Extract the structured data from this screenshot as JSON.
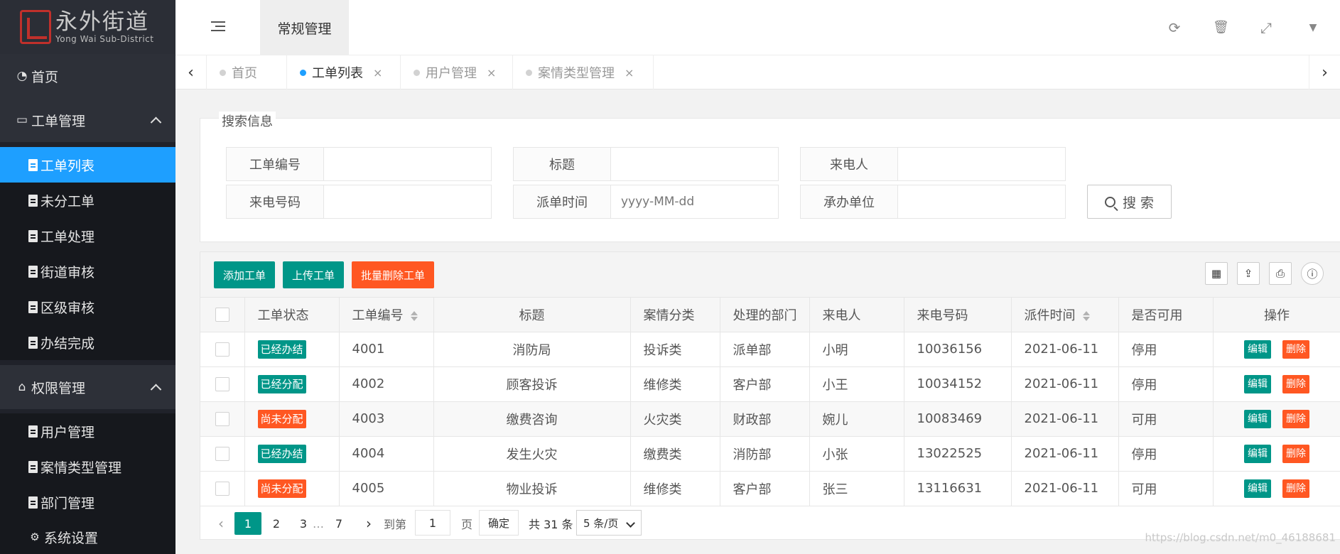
{
  "logo": {
    "title": "永外街道",
    "subtitle": "Yong Wai Sub-District"
  },
  "sidebar": {
    "home": "首页",
    "work_orders": {
      "label": "工单管理",
      "items": [
        "工单列表",
        "未分工单",
        "工单处理",
        "街道审核",
        "区级审核",
        "办结完成"
      ]
    },
    "permissions": {
      "label": "权限管理",
      "items": [
        "用户管理",
        "案情类型管理",
        "部门管理",
        "系统设置"
      ]
    }
  },
  "header": {
    "tab": "常规管理"
  },
  "tabs": [
    {
      "label": "首页"
    },
    {
      "label": "工单列表",
      "close": "×"
    },
    {
      "label": "用户管理",
      "close": "×"
    },
    {
      "label": "案情类型管理",
      "close": "×"
    }
  ],
  "search": {
    "legend": "搜索信息",
    "fields": [
      {
        "label": "工单编号",
        "placeholder": ""
      },
      {
        "label": "标题",
        "placeholder": ""
      },
      {
        "label": "来电人",
        "placeholder": ""
      },
      {
        "label": "来电号码",
        "placeholder": ""
      },
      {
        "label": "派单时间",
        "placeholder": "yyyy-MM-dd"
      },
      {
        "label": "承办单位",
        "placeholder": ""
      }
    ],
    "button": "搜 索"
  },
  "toolbar": {
    "add": "添加工单",
    "upload": "上传工单",
    "batch_delete": "批量删除工单"
  },
  "table": {
    "headers": [
      "工单状态",
      "工单编号",
      "标题",
      "案情分类",
      "处理的部门",
      "来电人",
      "来电号码",
      "派件时间",
      "是否可用",
      "操作"
    ],
    "edit_label": "编辑",
    "delete_label": "删除",
    "rows": [
      {
        "status": "已经办结",
        "status_type": "done",
        "id": "4001",
        "title": "消防局",
        "category": "投诉类",
        "dept": "派单部",
        "caller": "小明",
        "phone": "10036156",
        "date": "2021-06-11",
        "enabled": "停用"
      },
      {
        "status": "已经分配",
        "status_type": "done",
        "id": "4002",
        "title": "顾客投诉",
        "category": "维修类",
        "dept": "客户部",
        "caller": "小王",
        "phone": "10034152",
        "date": "2021-06-11",
        "enabled": "停用"
      },
      {
        "status": "尚未分配",
        "status_type": "pending",
        "id": "4003",
        "title": "缴费咨询",
        "category": "火灾类",
        "dept": "财政部",
        "caller": "婉儿",
        "phone": "10083469",
        "date": "2021-06-11",
        "enabled": "可用"
      },
      {
        "status": "已经办结",
        "status_type": "done",
        "id": "4004",
        "title": "发生火灾",
        "category": "缴费类",
        "dept": "消防部",
        "caller": "小张",
        "phone": "13022525",
        "date": "2021-06-11",
        "enabled": "停用"
      },
      {
        "status": "尚未分配",
        "status_type": "pending",
        "id": "4005",
        "title": "物业投诉",
        "category": "维修类",
        "dept": "客户部",
        "caller": "张三",
        "phone": "13116631",
        "date": "2021-06-11",
        "enabled": "可用"
      }
    ]
  },
  "pager": {
    "pages": [
      "1",
      "2",
      "3",
      "…",
      "7"
    ],
    "goto_label": "到第",
    "goto_value": "1",
    "page_unit": "页",
    "confirm": "确定",
    "total": "共 31 条",
    "page_size": "5 条/页"
  },
  "watermark": "https://blog.csdn.net/m0_46188681",
  "colors": {
    "primary": "#009688",
    "danger": "#ff5722",
    "active_nav": "#1e9fff",
    "sidebar_bg": "#20222a"
  }
}
